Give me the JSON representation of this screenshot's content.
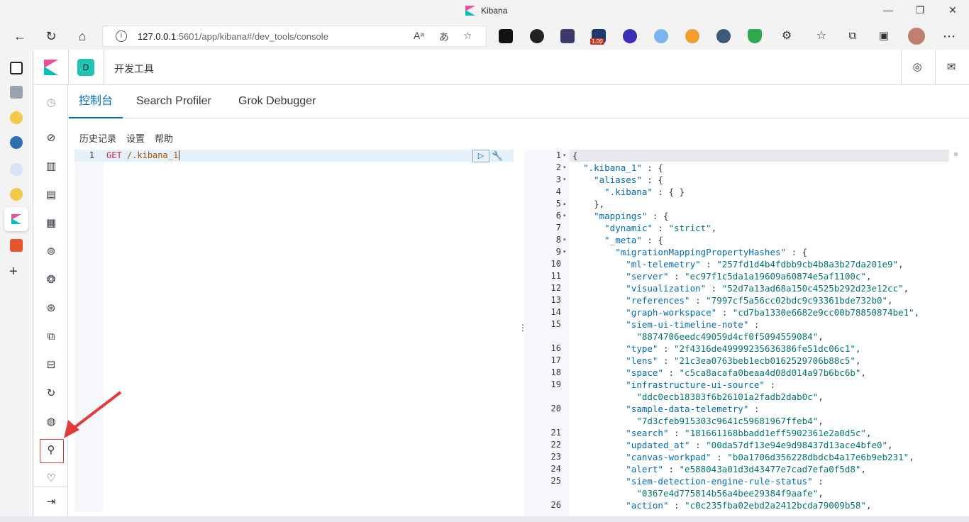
{
  "window": {
    "title": "Kibana",
    "minimize": "—",
    "maximize": "❐",
    "close": "✕"
  },
  "browser": {
    "url_host": "127.0.0.1",
    "url_rest": ":5601/app/kibana#/dev_tools/console",
    "ext_badge": "1.00"
  },
  "kibana": {
    "space_initial": "D",
    "breadcrumb": "开发工具",
    "tabs": [
      {
        "label": "控制台",
        "active": true
      },
      {
        "label": "Search Profiler",
        "active": false
      },
      {
        "label": "Grok Debugger",
        "active": false
      }
    ],
    "submenu": [
      "历史记录",
      "设置",
      "帮助"
    ],
    "editor": {
      "line_number": "1",
      "method": "GET",
      "path": "/.kibana_1"
    },
    "output_lines": [
      {
        "n": "1",
        "fold": "▾",
        "text": "{"
      },
      {
        "n": "2",
        "fold": "▾",
        "text": "  \".kibana_1\" : {"
      },
      {
        "n": "3",
        "fold": "▾",
        "text": "    \"aliases\" : {"
      },
      {
        "n": "4",
        "fold": "",
        "text": "      \".kibana\" : { }"
      },
      {
        "n": "5",
        "fold": "▴",
        "text": "    },"
      },
      {
        "n": "6",
        "fold": "▾",
        "text": "    \"mappings\" : {"
      },
      {
        "n": "7",
        "fold": "",
        "text": "      \"dynamic\" : \"strict\","
      },
      {
        "n": "8",
        "fold": "▾",
        "text": "      \"_meta\" : {"
      },
      {
        "n": "9",
        "fold": "▾",
        "text": "        \"migrationMappingPropertyHashes\" : {"
      },
      {
        "n": "10",
        "fold": "",
        "text": "          \"ml-telemetry\" : \"257fd1d4b4fdbb9cb4b8a3b27da201e9\","
      },
      {
        "n": "11",
        "fold": "",
        "text": "          \"server\" : \"ec97f1c5da1a19609a60874e5af1100c\","
      },
      {
        "n": "12",
        "fold": "",
        "text": "          \"visualization\" : \"52d7a13ad68a150c4525b292d23e12cc\","
      },
      {
        "n": "13",
        "fold": "",
        "text": "          \"references\" : \"7997cf5a56cc02bdc9c93361bde732b0\","
      },
      {
        "n": "14",
        "fold": "",
        "text": "          \"graph-workspace\" : \"cd7ba1330e6682e9cc00b78850874be1\","
      },
      {
        "n": "15",
        "fold": "",
        "text": "          \"siem-ui-timeline-note\" :"
      },
      {
        "n": "",
        "fold": "",
        "text": "            \"8874706eedc49059d4cf0f5094559084\","
      },
      {
        "n": "16",
        "fold": "",
        "text": "          \"type\" : \"2f4316de49999235636386fe51dc06c1\","
      },
      {
        "n": "17",
        "fold": "",
        "text": "          \"lens\" : \"21c3ea0763beb1ecb0162529706b88c5\","
      },
      {
        "n": "18",
        "fold": "",
        "text": "          \"space\" : \"c5ca8acafa0beaa4d08d014a97b6bc6b\","
      },
      {
        "n": "19",
        "fold": "",
        "text": "          \"infrastructure-ui-source\" :"
      },
      {
        "n": "",
        "fold": "",
        "text": "            \"ddc0ecb18383f6b26101a2fadb2dab0c\","
      },
      {
        "n": "20",
        "fold": "",
        "text": "          \"sample-data-telemetry\" :"
      },
      {
        "n": "",
        "fold": "",
        "text": "            \"7d3cfeb915303c9641c59681967ffeb4\","
      },
      {
        "n": "21",
        "fold": "",
        "text": "          \"search\" : \"181661168bbadd1eff5902361e2a0d5c\","
      },
      {
        "n": "22",
        "fold": "",
        "text": "          \"updated_at\" : \"00da57df13e94e9d98437d13ace4bfe0\","
      },
      {
        "n": "23",
        "fold": "",
        "text": "          \"canvas-workpad\" : \"b0a1706d356228dbdcb4a17e6b9eb231\","
      },
      {
        "n": "24",
        "fold": "",
        "text": "          \"alert\" : \"e588043a01d3d43477e7cad7efa0f5d8\","
      },
      {
        "n": "25",
        "fold": "",
        "text": "          \"siem-detection-engine-rule-status\" :"
      },
      {
        "n": "",
        "fold": "",
        "text": "            \"0367e4d775814b56a4bee29384f9aafe\","
      },
      {
        "n": "26",
        "fold": "",
        "text": "          \"action\" : \"c0c235fba02ebd2a2412bcda79009b58\","
      }
    ]
  },
  "colors": {
    "accent": "#006bb4",
    "highlight_box": "#e23b3b"
  }
}
